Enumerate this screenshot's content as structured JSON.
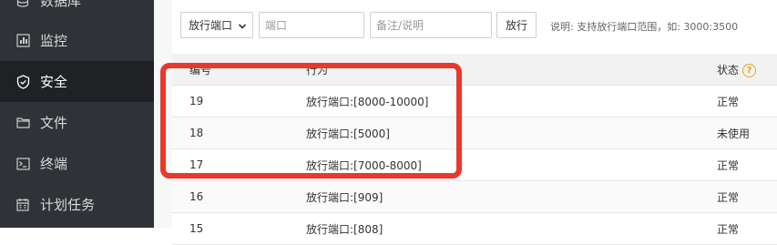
{
  "sidebar": {
    "items": [
      {
        "label": "数据库",
        "icon": "database-icon"
      },
      {
        "label": "监控",
        "icon": "monitor-icon"
      },
      {
        "label": "安全",
        "icon": "shield-icon",
        "active": true
      },
      {
        "label": "文件",
        "icon": "folder-icon"
      },
      {
        "label": "终端",
        "icon": "terminal-icon"
      },
      {
        "label": "计划任务",
        "icon": "calendar-icon"
      }
    ]
  },
  "toolbar": {
    "select_value": "放行端口",
    "port_placeholder": "端口",
    "note_placeholder": "备注/说明",
    "allow_button": "放行",
    "hint": "说明: 支持放行端口范围，如: 3000:3500"
  },
  "table": {
    "headers": {
      "id": "编号",
      "action": "行为",
      "status": "状态"
    },
    "rows": [
      {
        "id": "19",
        "action": "放行端口:[8000-10000]",
        "status": "正常"
      },
      {
        "id": "18",
        "action": "放行端口:[5000]",
        "status": "未使用"
      },
      {
        "id": "17",
        "action": "放行端口:[7000-8000]",
        "status": "正常"
      },
      {
        "id": "16",
        "action": "放行端口:[909]",
        "status": "正常"
      },
      {
        "id": "15",
        "action": "放行端口:[808]",
        "status": "正常"
      }
    ]
  },
  "colors": {
    "highlight": "#e8392c",
    "help": "#f0a020",
    "sidebar": "#2f3237"
  }
}
